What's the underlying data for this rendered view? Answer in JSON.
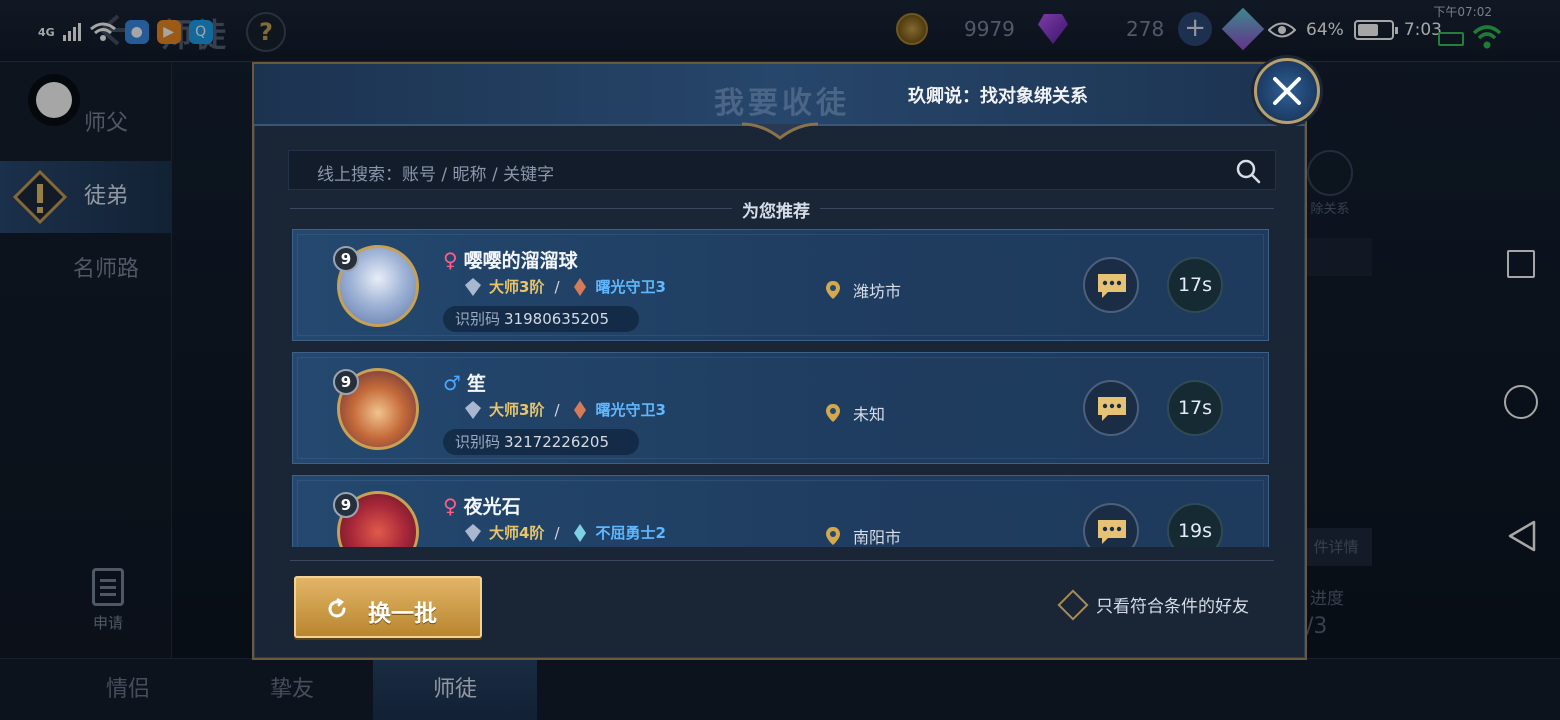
{
  "status_bar": {
    "network": "4G",
    "battery": "64%",
    "battery_level": 0.64,
    "time": "7:03",
    "time_secondary": "下午07:02"
  },
  "game_header": {
    "title": "师徒",
    "help": "?",
    "coins": "9979",
    "gems": "278",
    "plus": "+"
  },
  "sidebar": {
    "items": [
      {
        "label": "师父"
      },
      {
        "label": "徒弟"
      },
      {
        "label": "名师路"
      }
    ],
    "apply_label": "申请"
  },
  "background_panel": {
    "unbind_label": "除关系",
    "detail_label": "件详情",
    "progress_label": "进度",
    "progress_value": "/3"
  },
  "bottom_tabs": [
    {
      "label": "情侣"
    },
    {
      "label": "挚友"
    },
    {
      "label": "师徒"
    }
  ],
  "modal": {
    "title": "我要收徒",
    "subtitle": "玖卿说：找对象绑关系",
    "search_placeholder": "线上搜索：账号 / 昵称 / 关键字",
    "recommend_label": "为您推荐",
    "refresh_label": "换一批",
    "filter_label": "只看符合条件的好友",
    "id_prefix": "识别码",
    "candidates": [
      {
        "level": "9",
        "gender": "female",
        "name": "嘤嘤的溜溜球",
        "rank": "大师3阶",
        "rank2": "曙光守卫3",
        "id": "31980635205",
        "location": "潍坊市",
        "timer": "17s"
      },
      {
        "level": "9",
        "gender": "male",
        "name": "笙",
        "rank": "大师3阶",
        "rank2": "曙光守卫3",
        "id": "32172226205",
        "location": "未知",
        "timer": "17s"
      },
      {
        "level": "9",
        "gender": "female",
        "name": "夜光石",
        "rank": "大师4阶",
        "rank2": "不屈勇士2",
        "id": "",
        "location": "南阳市",
        "timer": "19s"
      }
    ]
  },
  "colors": {
    "accent_gold": "#c8a154",
    "card_blue": "#24486f",
    "female": "#ff5d8a",
    "male": "#4ca6ff"
  }
}
